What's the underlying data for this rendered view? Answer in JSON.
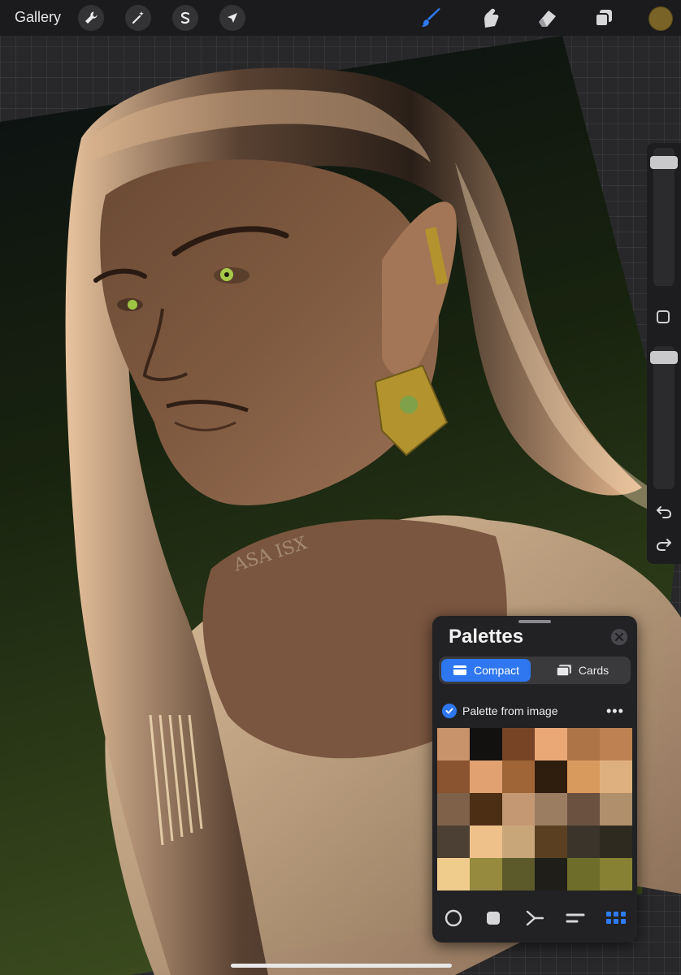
{
  "topbar": {
    "gallery_label": "Gallery",
    "left_tools": [
      {
        "name": "actions",
        "icon": "wrench-icon"
      },
      {
        "name": "adjustments",
        "icon": "magic-wand-icon"
      },
      {
        "name": "selection",
        "icon": "selection-s-icon"
      },
      {
        "name": "transform",
        "icon": "arrow-cursor-icon"
      }
    ],
    "right_tools": [
      {
        "name": "brush",
        "icon": "brush-icon",
        "active": true
      },
      {
        "name": "smudge",
        "icon": "smudge-finger-icon"
      },
      {
        "name": "eraser",
        "icon": "eraser-icon"
      },
      {
        "name": "layers",
        "icon": "layers-icon"
      }
    ],
    "current_color": "#7a6326",
    "active_color": "#2e7bf5"
  },
  "sidebar": {
    "brush_size_level": 0.15,
    "opacity_level": 0.05,
    "icons": [
      "modify-square-icon",
      "undo-icon",
      "redo-icon"
    ]
  },
  "palettes_panel": {
    "title": "Palettes",
    "tabs": [
      {
        "label": "Compact",
        "active": true,
        "icon": "compact-card-icon"
      },
      {
        "label": "Cards",
        "active": false,
        "icon": "cards-stack-icon"
      }
    ],
    "palette_name": "Palette from image",
    "palette_default": true,
    "swatches": [
      "#c8926a",
      "#121110",
      "#774525",
      "#eaa877",
      "#ad7447",
      "#be8252",
      "#8a5430",
      "#e2a171",
      "#9f6536",
      "#2f1d0e",
      "#d99a5d",
      "#dfb07f",
      "#7f6149",
      "#4b2e14",
      "#c49872",
      "#9b7d62",
      "#6a5140",
      "#b08f6c",
      "#4c4034",
      "#eec08a",
      "#c9a57a",
      "#5a4020",
      "#3b342b",
      "#2f2a20",
      "#f0cc8c",
      "#968a3f",
      "#5c5a2a",
      "#1f1e19",
      "#6f6d2a",
      "#868133"
    ],
    "footer_icons": [
      "disc-mode-icon",
      "classic-mode-icon",
      "harmony-mode-icon",
      "value-mode-icon",
      "palettes-mode-icon"
    ],
    "footer_active": "palettes-mode-icon"
  },
  "artwork": {
    "signature": "ASA ISX"
  }
}
